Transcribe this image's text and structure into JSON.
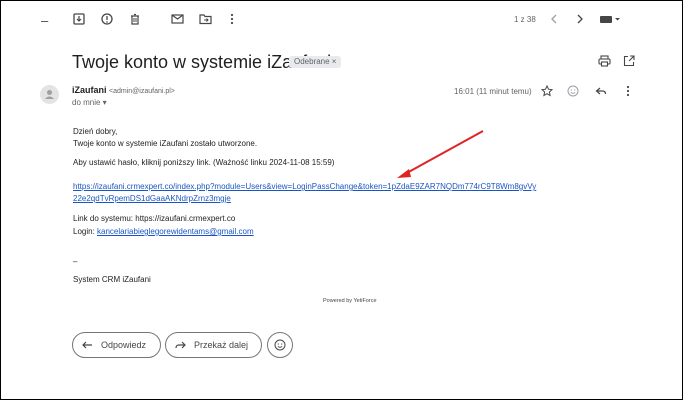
{
  "toolbar": {
    "dash": "–",
    "pager": "1 z 38"
  },
  "email": {
    "subject": "Twoje konto w systemie iZaufani",
    "label_chip": "Odebrane ×",
    "sender_name": "iZaufani",
    "sender_email": "<admin@izaufani.pl>",
    "to_me": "do mnie ▾",
    "time": "16:01 (11 minut temu)",
    "lines": {
      "greeting": "Dzień dobry,",
      "created": "Twoje konto w systemie iZaufani zostało utworzone.",
      "set_password": "Aby ustawić hasło, kliknij poniższy link. (Ważność linku 2024-11-08 15:59)",
      "link1": "https://izaufani.crmexpert.co/index.php?module=Users&view=LoginPassChange&token=1pZdaE9ZAR7NQDm774rC9T8Wm8gvVy",
      "link2": "22e2qdTvRpemDS1dGaaAKNdrpZrnz3mgje",
      "system_link": "Link do systemu: https://izaufani.crmexpert.co",
      "login_prefix": "Login: ",
      "login_email": "kancelariabieglegorewidentams@gmail.com",
      "dash": "–",
      "signature": "System CRM iZaufani"
    },
    "powered_by": "Powered by YetiForce"
  },
  "actions": {
    "reply": "Odpowiedz",
    "forward": "Przekaż dalej"
  },
  "colors": {
    "link": "#1a55c5",
    "arrow": "#e02424"
  }
}
